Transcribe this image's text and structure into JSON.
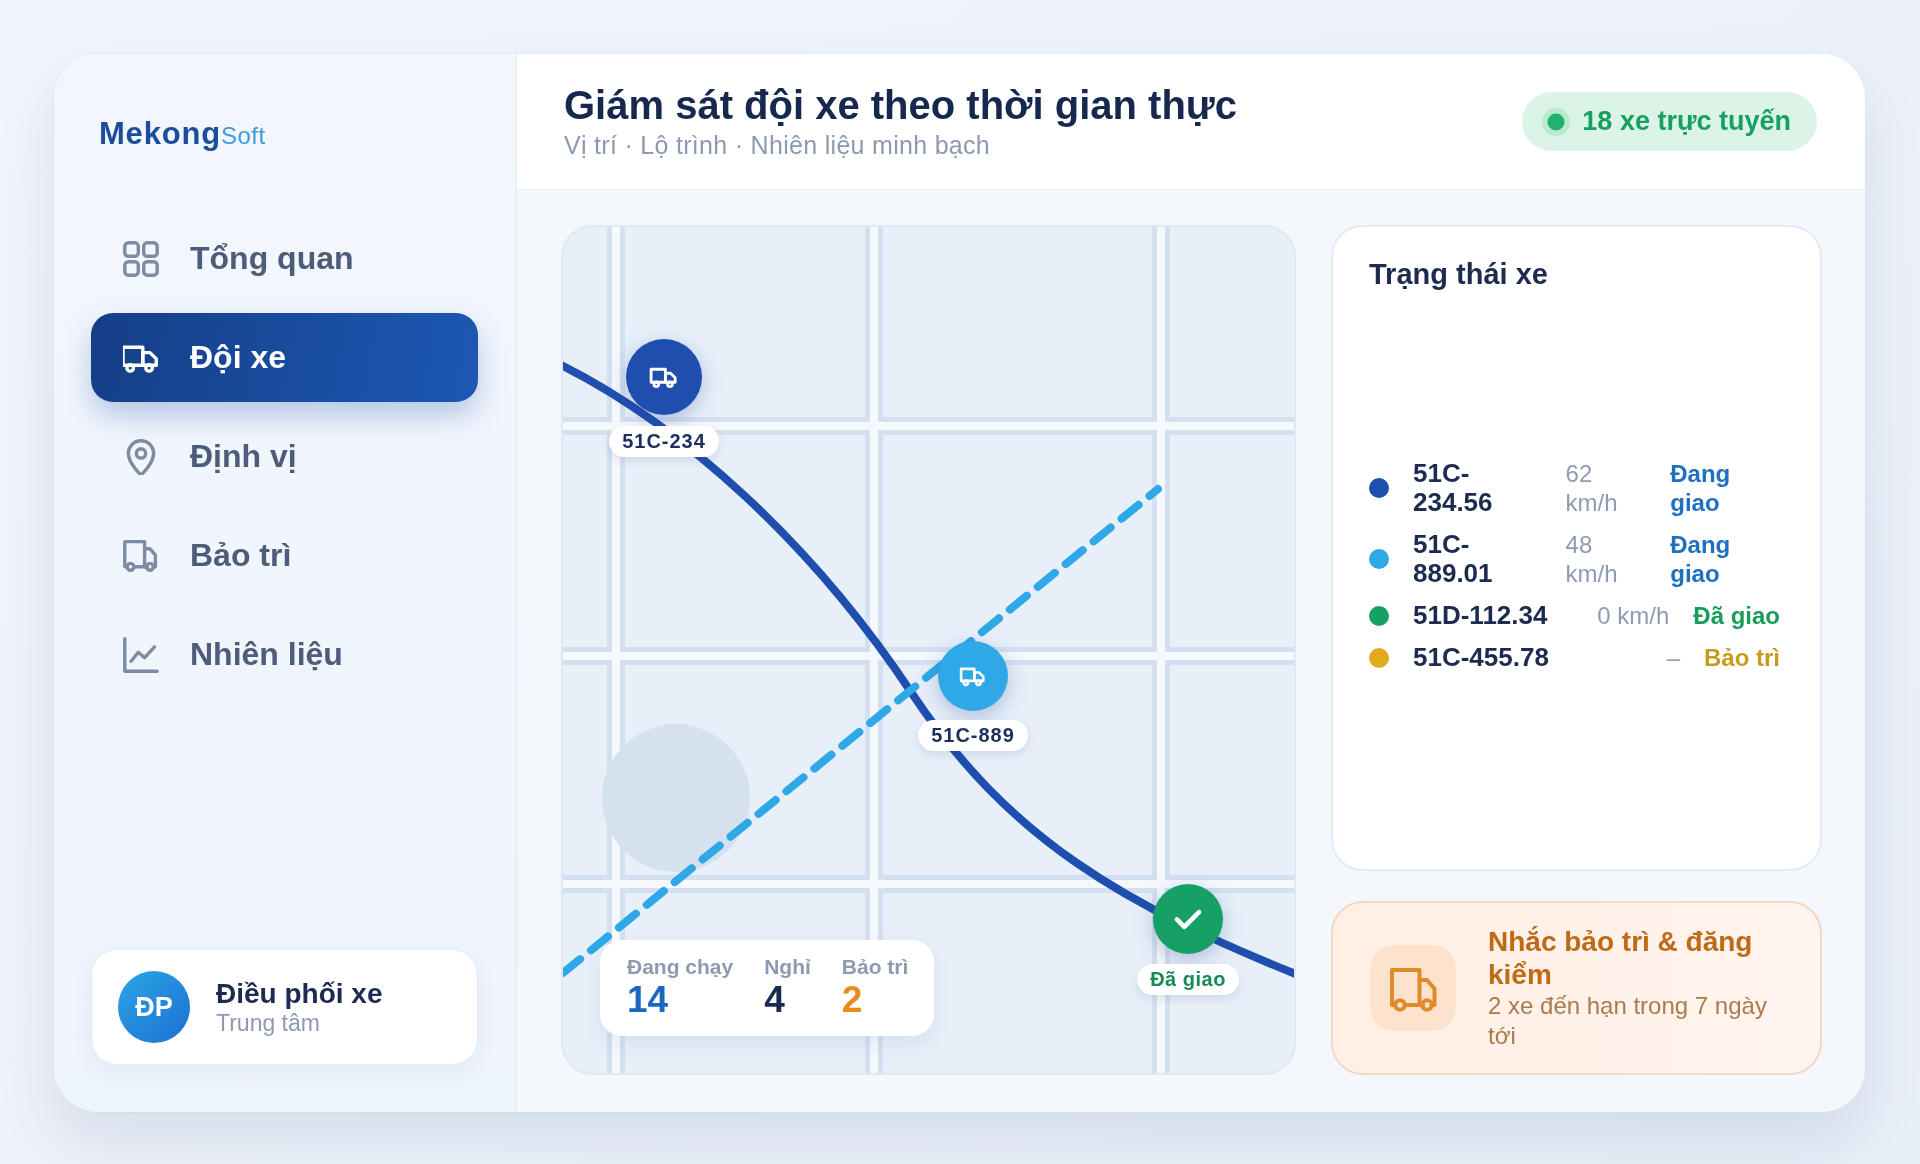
{
  "brand": {
    "name": "Mekong",
    "suffix": "Soft"
  },
  "sidebar": {
    "items": [
      {
        "label": "Tổng quan",
        "selected": false
      },
      {
        "label": "Đội xe",
        "selected": true
      },
      {
        "label": "Định vị",
        "selected": false
      },
      {
        "label": "Bảo trì",
        "selected": false
      },
      {
        "label": "Nhiên liệu",
        "selected": false
      }
    ]
  },
  "user": {
    "initials": "ĐP",
    "name": "Điều phối xe",
    "role": "Trung tâm"
  },
  "header": {
    "title": "Giám sát đội xe theo thời gian thực",
    "subtitle": "Vị trí · Lộ trình · Nhiên liệu minh bạch",
    "online_badge": "18 xe trực tuyến"
  },
  "map": {
    "markers": [
      {
        "kind": "truck",
        "label": "51C-234",
        "color": "#1f4fae"
      },
      {
        "kind": "truck",
        "label": "51C-889",
        "color": "#2ea8e6"
      },
      {
        "kind": "check",
        "label": "Đã giao",
        "color": "#17a066"
      }
    ],
    "stats": [
      {
        "label": "Đang chạy",
        "value": "14",
        "color": "#1b67c2"
      },
      {
        "label": "Nghỉ",
        "value": "4",
        "color": "#1a2b50"
      },
      {
        "label": "Bảo trì",
        "value": "2",
        "color": "#e88b1c"
      }
    ]
  },
  "status_panel": {
    "title": "Trạng thái xe",
    "vehicles": [
      {
        "plate": "51C-234.56",
        "speed": "62 km/h",
        "status": {
          "label": "Đang giao",
          "color": "#2070c2"
        },
        "color": "#1d4fae"
      },
      {
        "plate": "51C-889.01",
        "speed": "48 km/h",
        "status": {
          "label": "Đang giao",
          "color": "#2070c2"
        },
        "color": "#2ea8e8"
      },
      {
        "plate": "51D-112.34",
        "speed": "0 km/h",
        "status": {
          "label": "Đã giao",
          "color": "#179c5a"
        },
        "color": "#17a066"
      },
      {
        "plate": "51C-455.78",
        "speed": "–",
        "status": {
          "label": "Bảo trì",
          "color": "#c99a1e"
        },
        "color": "#e2aa1e"
      }
    ]
  },
  "alert": {
    "title": "Nhắc bảo trì & đăng kiểm",
    "text": "2 xe đến hạn trong 7 ngày tới"
  }
}
